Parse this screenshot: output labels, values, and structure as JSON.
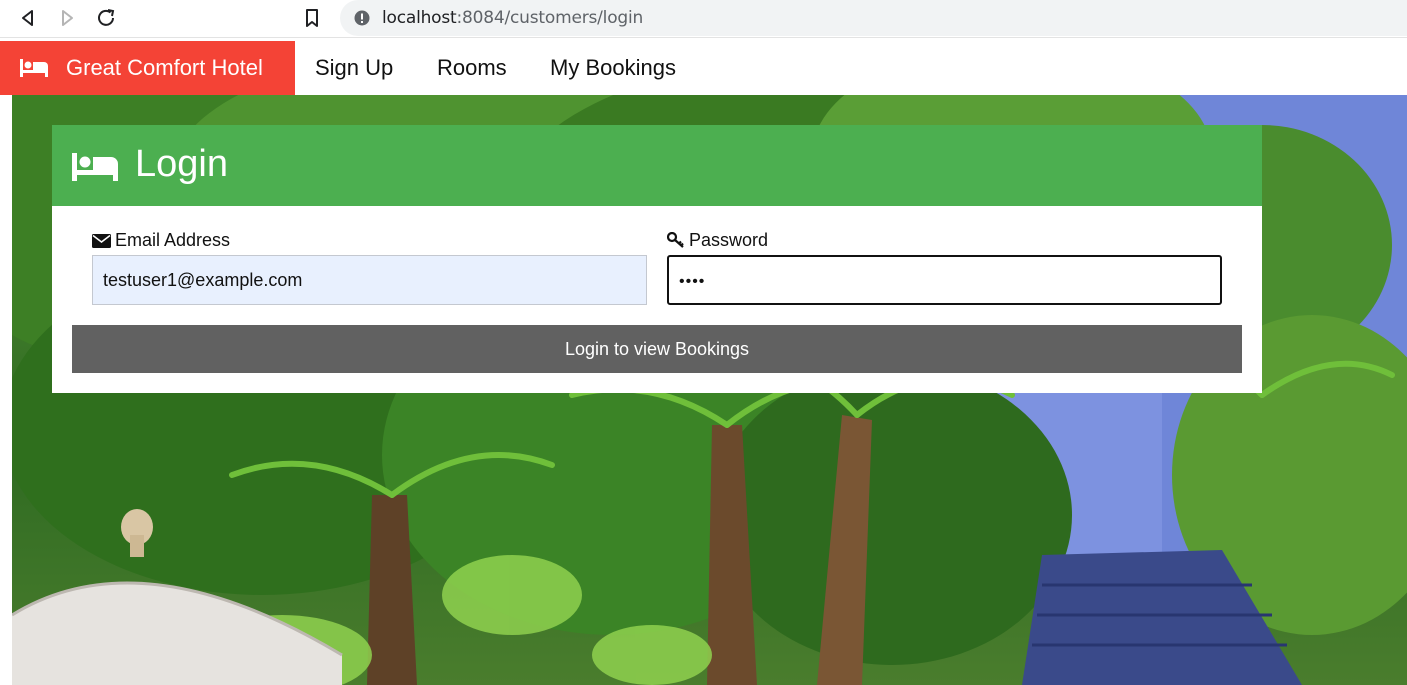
{
  "browser": {
    "url_host": "localhost",
    "url_path": ":8084/customers/login"
  },
  "nav": {
    "brand": "Great Comfort Hotel",
    "links": [
      "Sign Up",
      "Rooms",
      "My Bookings"
    ]
  },
  "login": {
    "title": "Login",
    "email_label": "Email Address",
    "email_value": "testuser1@example.com",
    "password_label": "Password",
    "password_value": "••••",
    "submit_label": "Login to view Bookings"
  },
  "colors": {
    "brand": "#f44336",
    "card_header": "#4caf50",
    "button": "#616161",
    "autofill": "#e8f0fe"
  }
}
